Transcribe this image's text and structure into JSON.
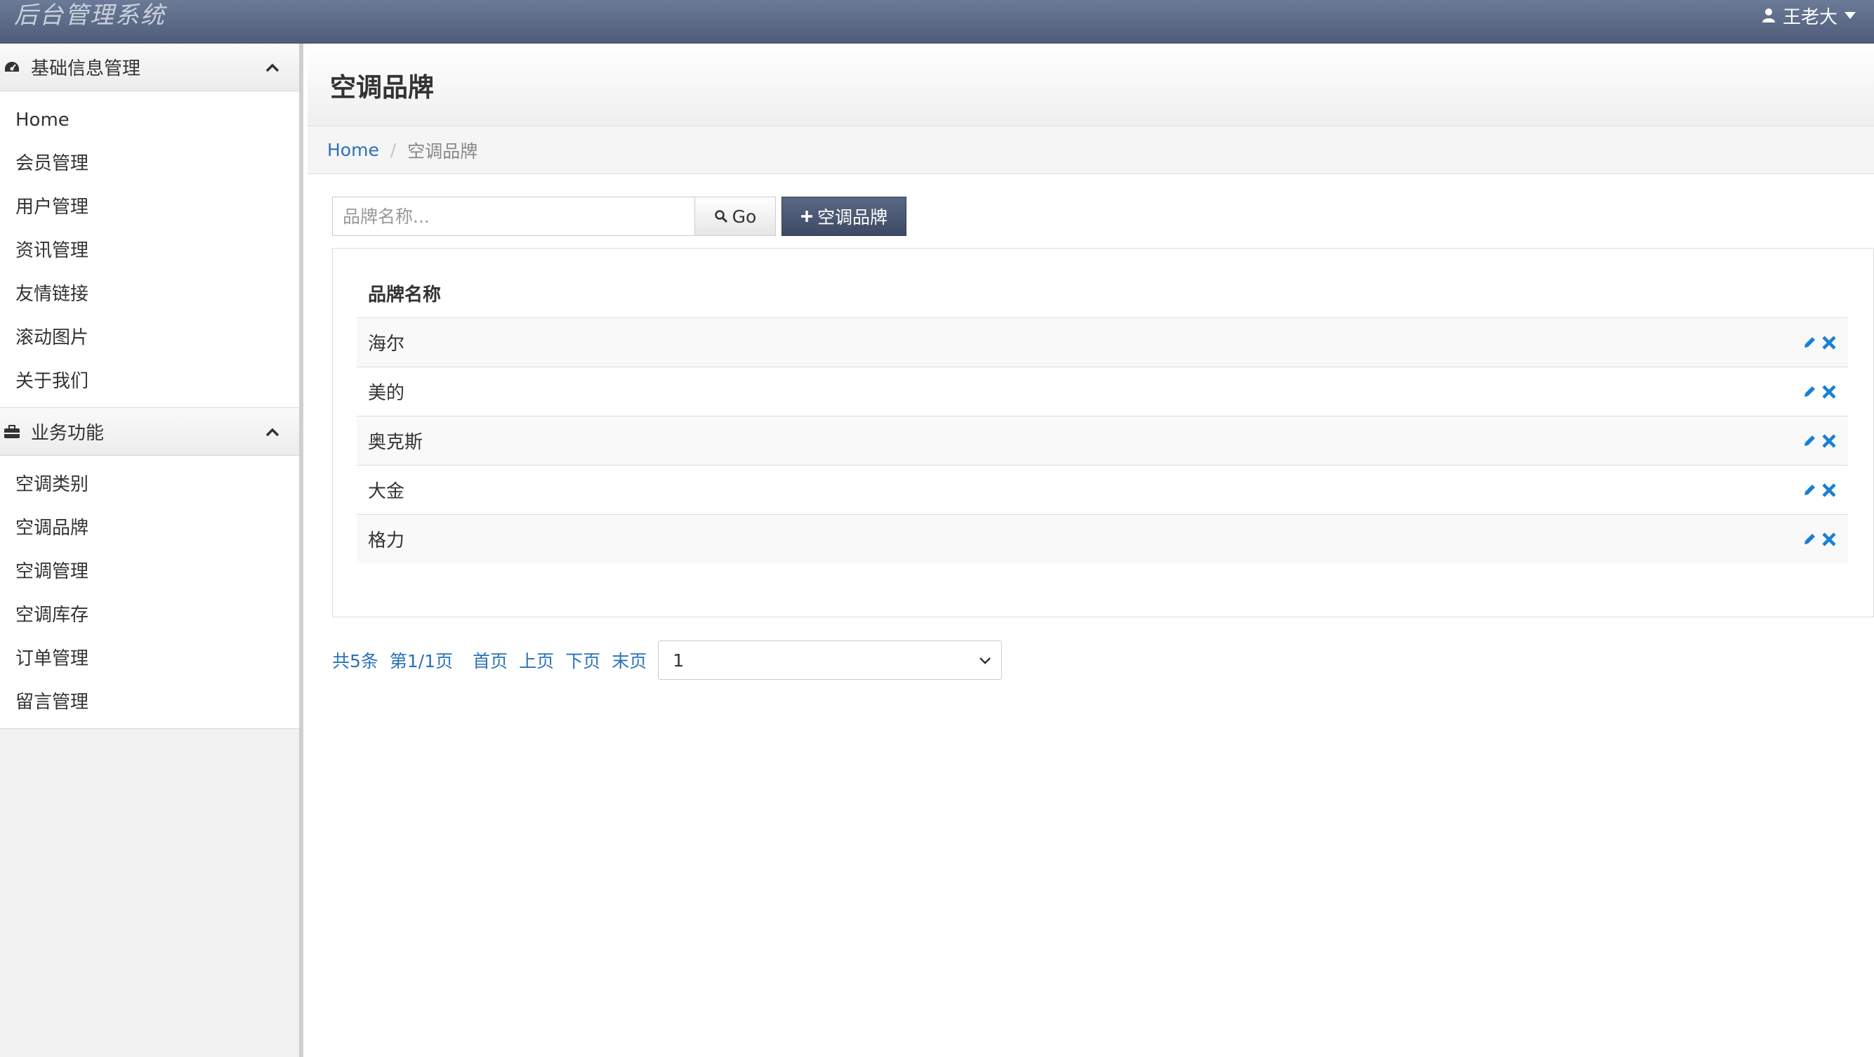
{
  "app": {
    "title": "后台管理系统",
    "user_name": "王老大"
  },
  "sidebar": {
    "groups": [
      {
        "title": "基础信息管理",
        "icon": "dashboard-icon",
        "items": [
          "Home",
          "会员管理",
          "用户管理",
          "资讯管理",
          "友情链接",
          "滚动图片",
          "关于我们"
        ]
      },
      {
        "title": "业务功能",
        "icon": "briefcase-icon",
        "items": [
          "空调类别",
          "空调品牌",
          "空调管理",
          "空调库存",
          "订单管理",
          "留言管理"
        ]
      }
    ]
  },
  "page": {
    "title": "空调品牌",
    "breadcrumb": {
      "home": "Home",
      "current": "空调品牌"
    }
  },
  "toolbar": {
    "search_placeholder": "品牌名称...",
    "go_label": "Go",
    "add_label": "空调品牌"
  },
  "table": {
    "header": "品牌名称",
    "rows": [
      "海尔",
      "美的",
      "奥克斯",
      "大金",
      "格力"
    ]
  },
  "pager": {
    "total": "共5条",
    "page_info": "第1/1页",
    "first": "首页",
    "prev": "上页",
    "next": "下页",
    "last": "末页",
    "selected_page": "1"
  },
  "colors": {
    "topbar": "#5b6884",
    "link": "#2a72b8",
    "action_icon": "#1a7fd4"
  }
}
